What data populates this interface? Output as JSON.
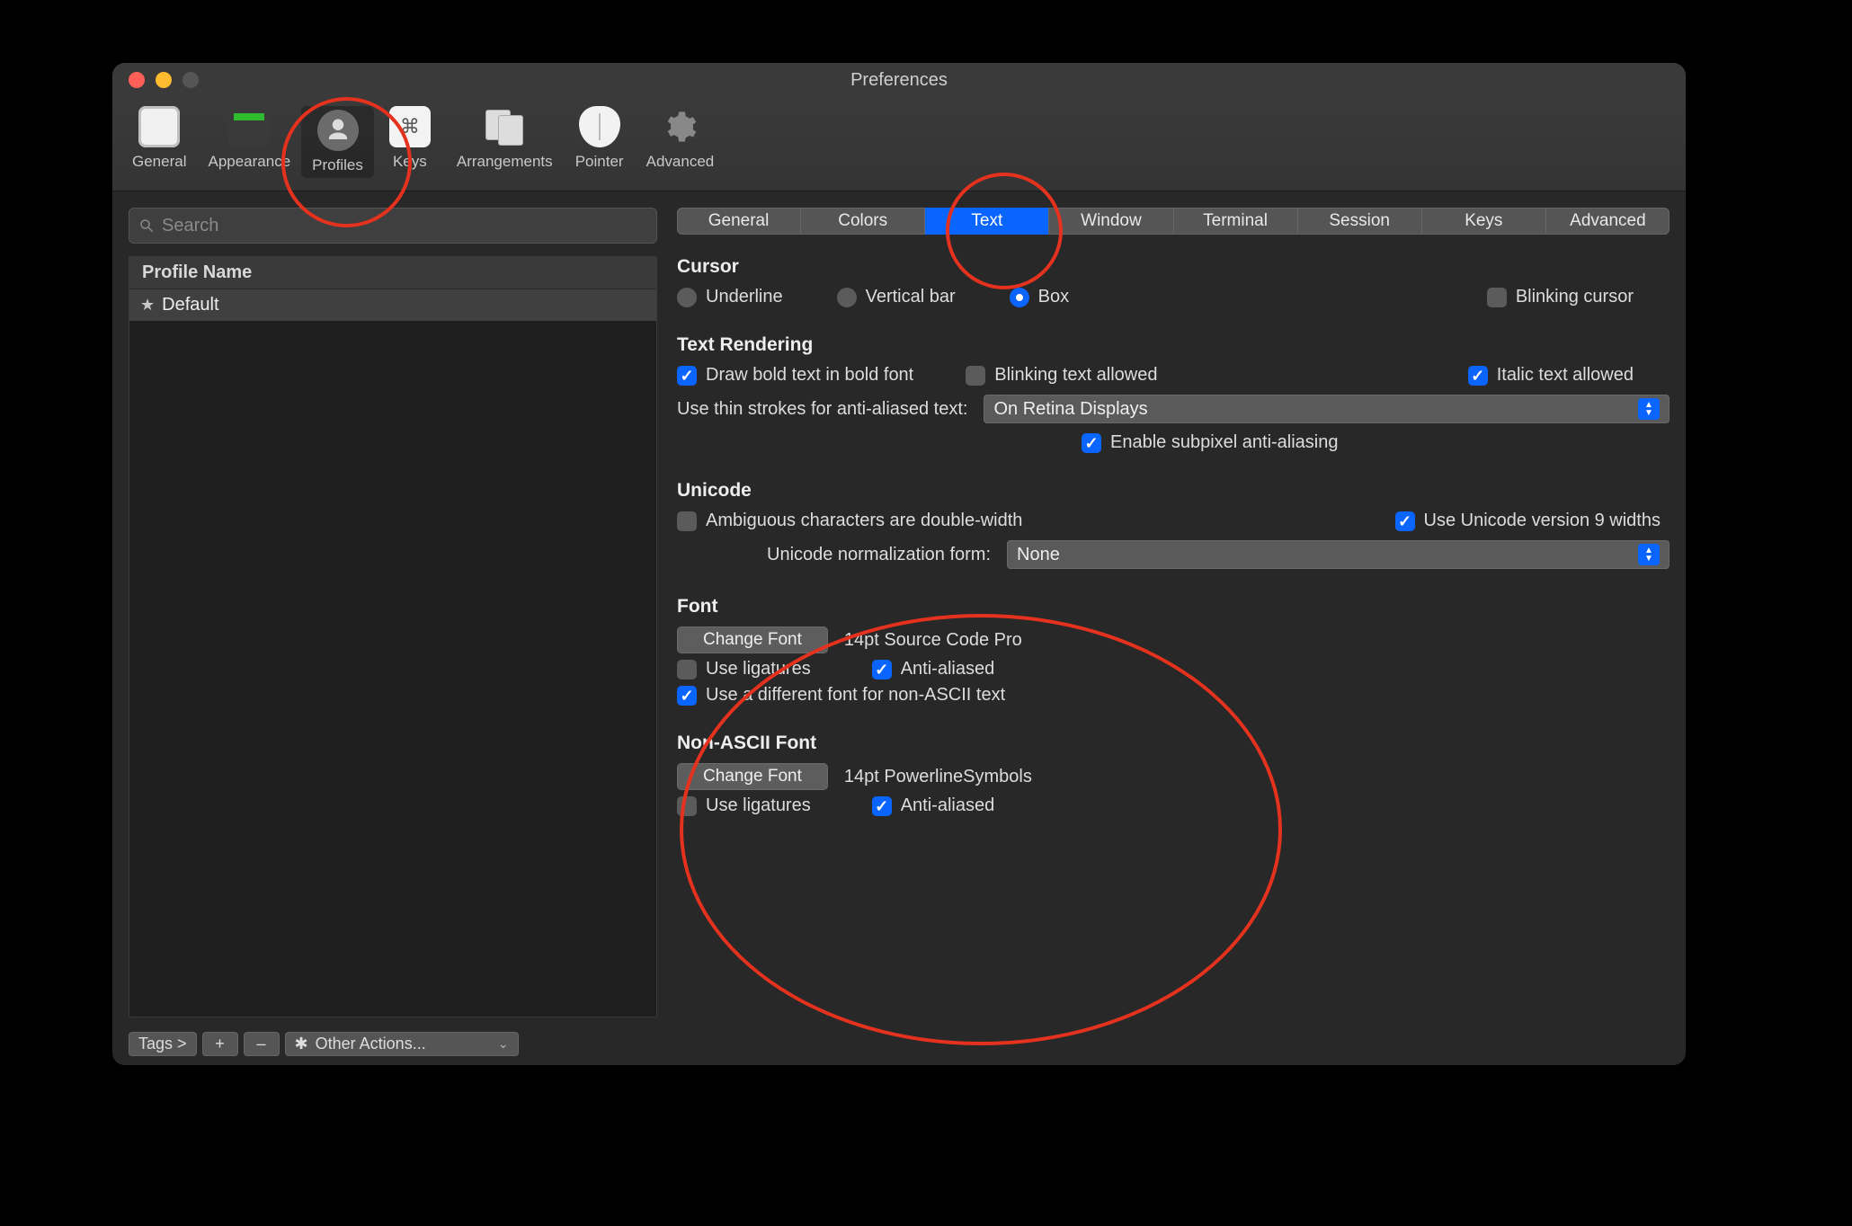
{
  "window": {
    "title": "Preferences"
  },
  "toolbar": {
    "items": [
      {
        "label": "General"
      },
      {
        "label": "Appearance"
      },
      {
        "label": "Profiles"
      },
      {
        "label": "Keys"
      },
      {
        "label": "Arrangements"
      },
      {
        "label": "Pointer"
      },
      {
        "label": "Advanced"
      }
    ],
    "active_index": 2
  },
  "sidebar": {
    "search_placeholder": "Search",
    "header": "Profile Name",
    "profiles": [
      {
        "name": "Default",
        "starred": true
      }
    ],
    "bottom": {
      "tags_label": "Tags >",
      "plus": "+",
      "minus": "–",
      "other_actions": "Other Actions..."
    }
  },
  "tabs": {
    "items": [
      "General",
      "Colors",
      "Text",
      "Window",
      "Terminal",
      "Session",
      "Keys",
      "Advanced"
    ],
    "selected_index": 2
  },
  "cursor": {
    "heading": "Cursor",
    "options": [
      "Underline",
      "Vertical bar",
      "Box"
    ],
    "selected_index": 2,
    "blinking_label": "Blinking cursor",
    "blinking_checked": false
  },
  "text_rendering": {
    "heading": "Text Rendering",
    "bold_label": "Draw bold text in bold font",
    "bold_checked": true,
    "blink_label": "Blinking text allowed",
    "blink_checked": false,
    "italic_label": "Italic text allowed",
    "italic_checked": true,
    "thin_strokes_label": "Use thin strokes for anti-aliased text:",
    "thin_strokes_value": "On Retina Displays",
    "subpixel_label": "Enable subpixel anti-aliasing",
    "subpixel_checked": true
  },
  "unicode": {
    "heading": "Unicode",
    "ambiguous_label": "Ambiguous characters are double-width",
    "ambiguous_checked": false,
    "v9_label": "Use Unicode version 9 widths",
    "v9_checked": true,
    "norm_label": "Unicode normalization form:",
    "norm_value": "None"
  },
  "font": {
    "heading": "Font",
    "change_label": "Change Font",
    "current": "14pt Source Code Pro",
    "ligatures_label": "Use ligatures",
    "ligatures_checked": false,
    "aa_label": "Anti-aliased",
    "aa_checked": true,
    "nonascii_toggle_label": "Use a different font for non-ASCII text",
    "nonascii_toggle_checked": true
  },
  "nonascii_font": {
    "heading": "Non-ASCII Font",
    "change_label": "Change Font",
    "current": "14pt PowerlineSymbols",
    "ligatures_label": "Use ligatures",
    "ligatures_checked": false,
    "aa_label": "Anti-aliased",
    "aa_checked": true
  }
}
